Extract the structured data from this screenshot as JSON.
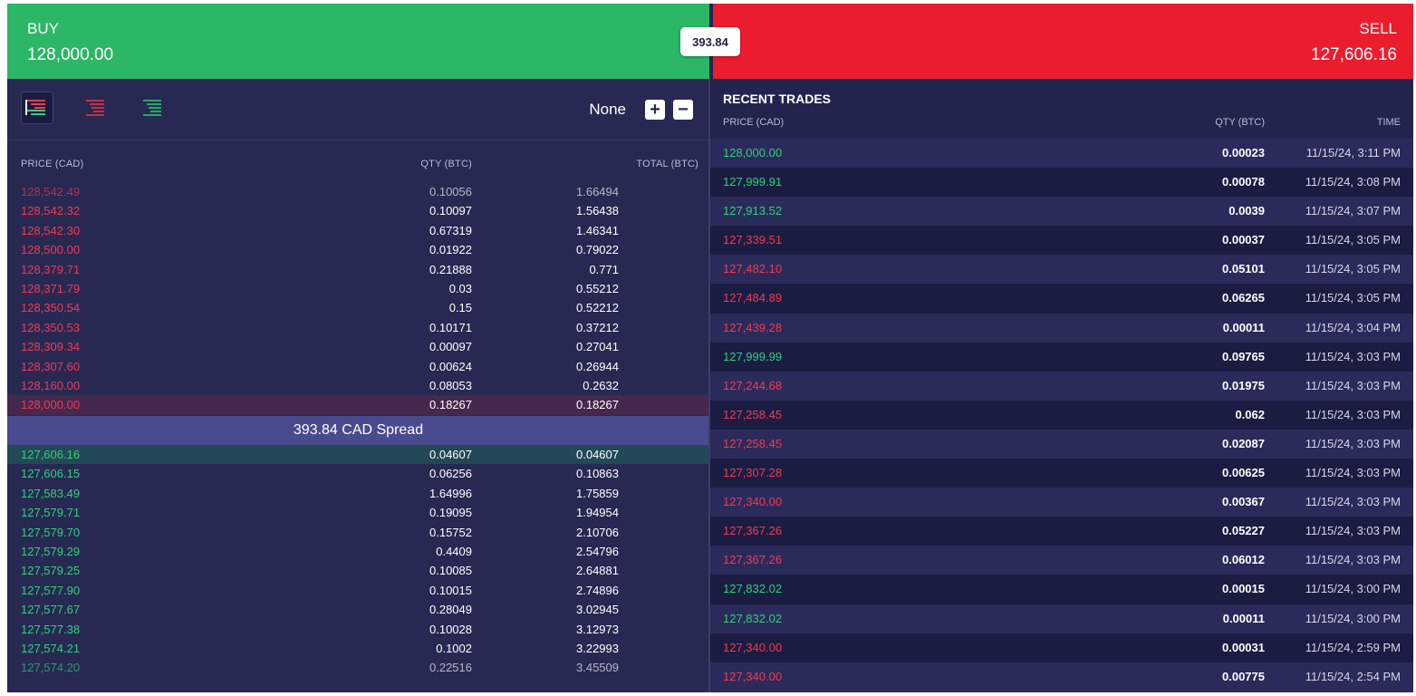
{
  "header": {
    "buy_label": "BUY",
    "buy_price": "128,000.00",
    "sell_label": "SELL",
    "sell_price": "127,606.16",
    "spread_pill": "393.84",
    "buy_color": "#2bb766",
    "sell_color": "#ec1c2f"
  },
  "order_book": {
    "view_buttons": [
      {
        "name": "view-both-icon",
        "active": true
      },
      {
        "name": "view-asks-icon",
        "active": false
      },
      {
        "name": "view-bids-icon",
        "active": false
      }
    ],
    "aggregation": "None",
    "headers": {
      "price": "PRICE (CAD)",
      "qty": "QTY (BTC)",
      "total": "TOTAL (BTC)"
    },
    "asks": [
      {
        "price": "128,542.49",
        "qty": "0.10056",
        "total": "1.66494"
      },
      {
        "price": "128,542.32",
        "qty": "0.10097",
        "total": "1.56438"
      },
      {
        "price": "128,542.30",
        "qty": "0.67319",
        "total": "1.46341"
      },
      {
        "price": "128,500.00",
        "qty": "0.01922",
        "total": "0.79022"
      },
      {
        "price": "128,379.71",
        "qty": "0.21888",
        "total": "0.771"
      },
      {
        "price": "128,371.79",
        "qty": "0.03",
        "total": "0.55212"
      },
      {
        "price": "128,350.54",
        "qty": "0.15",
        "total": "0.52212"
      },
      {
        "price": "128,350.53",
        "qty": "0.10171",
        "total": "0.37212"
      },
      {
        "price": "128,309.34",
        "qty": "0.00097",
        "total": "0.27041"
      },
      {
        "price": "128,307.60",
        "qty": "0.00624",
        "total": "0.26944"
      },
      {
        "price": "128,160.00",
        "qty": "0.08053",
        "total": "0.2632"
      },
      {
        "price": "128,000.00",
        "qty": "0.18267",
        "total": "0.18267"
      }
    ],
    "spread_text": "393.84 CAD Spread",
    "bids": [
      {
        "price": "127,606.16",
        "qty": "0.04607",
        "total": "0.04607"
      },
      {
        "price": "127,606.15",
        "qty": "0.06256",
        "total": "0.10863"
      },
      {
        "price": "127,583.49",
        "qty": "1.64996",
        "total": "1.75859"
      },
      {
        "price": "127,579.71",
        "qty": "0.19095",
        "total": "1.94954"
      },
      {
        "price": "127,579.70",
        "qty": "0.15752",
        "total": "2.10706"
      },
      {
        "price": "127,579.29",
        "qty": "0.4409",
        "total": "2.54796"
      },
      {
        "price": "127,579.25",
        "qty": "0.10085",
        "total": "2.64881"
      },
      {
        "price": "127,577.90",
        "qty": "0.10015",
        "total": "2.74896"
      },
      {
        "price": "127,577.67",
        "qty": "0.28049",
        "total": "3.02945"
      },
      {
        "price": "127,577.38",
        "qty": "0.10028",
        "total": "3.12973"
      },
      {
        "price": "127,574.21",
        "qty": "0.1002",
        "total": "3.22993"
      },
      {
        "price": "127,574.20",
        "qty": "0.22516",
        "total": "3.45509"
      }
    ]
  },
  "recent_trades": {
    "title": "RECENT TRADES",
    "headers": {
      "price": "PRICE (CAD)",
      "qty": "QTY (BTC)",
      "time": "TIME"
    },
    "rows": [
      {
        "price": "128,000.00",
        "qty": "0.00023",
        "time": "11/15/24, 3:11 PM",
        "side": "up"
      },
      {
        "price": "127,999.91",
        "qty": "0.00078",
        "time": "11/15/24, 3:08 PM",
        "side": "up"
      },
      {
        "price": "127,913.52",
        "qty": "0.0039",
        "time": "11/15/24, 3:07 PM",
        "side": "up"
      },
      {
        "price": "127,339.51",
        "qty": "0.00037",
        "time": "11/15/24, 3:05 PM",
        "side": "down"
      },
      {
        "price": "127,482.10",
        "qty": "0.05101",
        "time": "11/15/24, 3:05 PM",
        "side": "down"
      },
      {
        "price": "127,484.89",
        "qty": "0.06265",
        "time": "11/15/24, 3:05 PM",
        "side": "down"
      },
      {
        "price": "127,439.28",
        "qty": "0.00011",
        "time": "11/15/24, 3:04 PM",
        "side": "down"
      },
      {
        "price": "127,999.99",
        "qty": "0.09765",
        "time": "11/15/24, 3:03 PM",
        "side": "up"
      },
      {
        "price": "127,244.68",
        "qty": "0.01975",
        "time": "11/15/24, 3:03 PM",
        "side": "down"
      },
      {
        "price": "127,258.45",
        "qty": "0.062",
        "time": "11/15/24, 3:03 PM",
        "side": "down"
      },
      {
        "price": "127,258.45",
        "qty": "0.02087",
        "time": "11/15/24, 3:03 PM",
        "side": "down"
      },
      {
        "price": "127,307.28",
        "qty": "0.00625",
        "time": "11/15/24, 3:03 PM",
        "side": "down"
      },
      {
        "price": "127,340.00",
        "qty": "0.00367",
        "time": "11/15/24, 3:03 PM",
        "side": "down"
      },
      {
        "price": "127,367.26",
        "qty": "0.05227",
        "time": "11/15/24, 3:03 PM",
        "side": "down"
      },
      {
        "price": "127,367.26",
        "qty": "0.06012",
        "time": "11/15/24, 3:03 PM",
        "side": "down"
      },
      {
        "price": "127,832.02",
        "qty": "0.00015",
        "time": "11/15/24, 3:00 PM",
        "side": "up"
      },
      {
        "price": "127,832.02",
        "qty": "0.00011",
        "time": "11/15/24, 3:00 PM",
        "side": "up"
      },
      {
        "price": "127,340.00",
        "qty": "0.00031",
        "time": "11/15/24, 2:59 PM",
        "side": "down"
      },
      {
        "price": "127,340.00",
        "qty": "0.00775",
        "time": "11/15/24, 2:54 PM",
        "side": "down"
      }
    ]
  }
}
